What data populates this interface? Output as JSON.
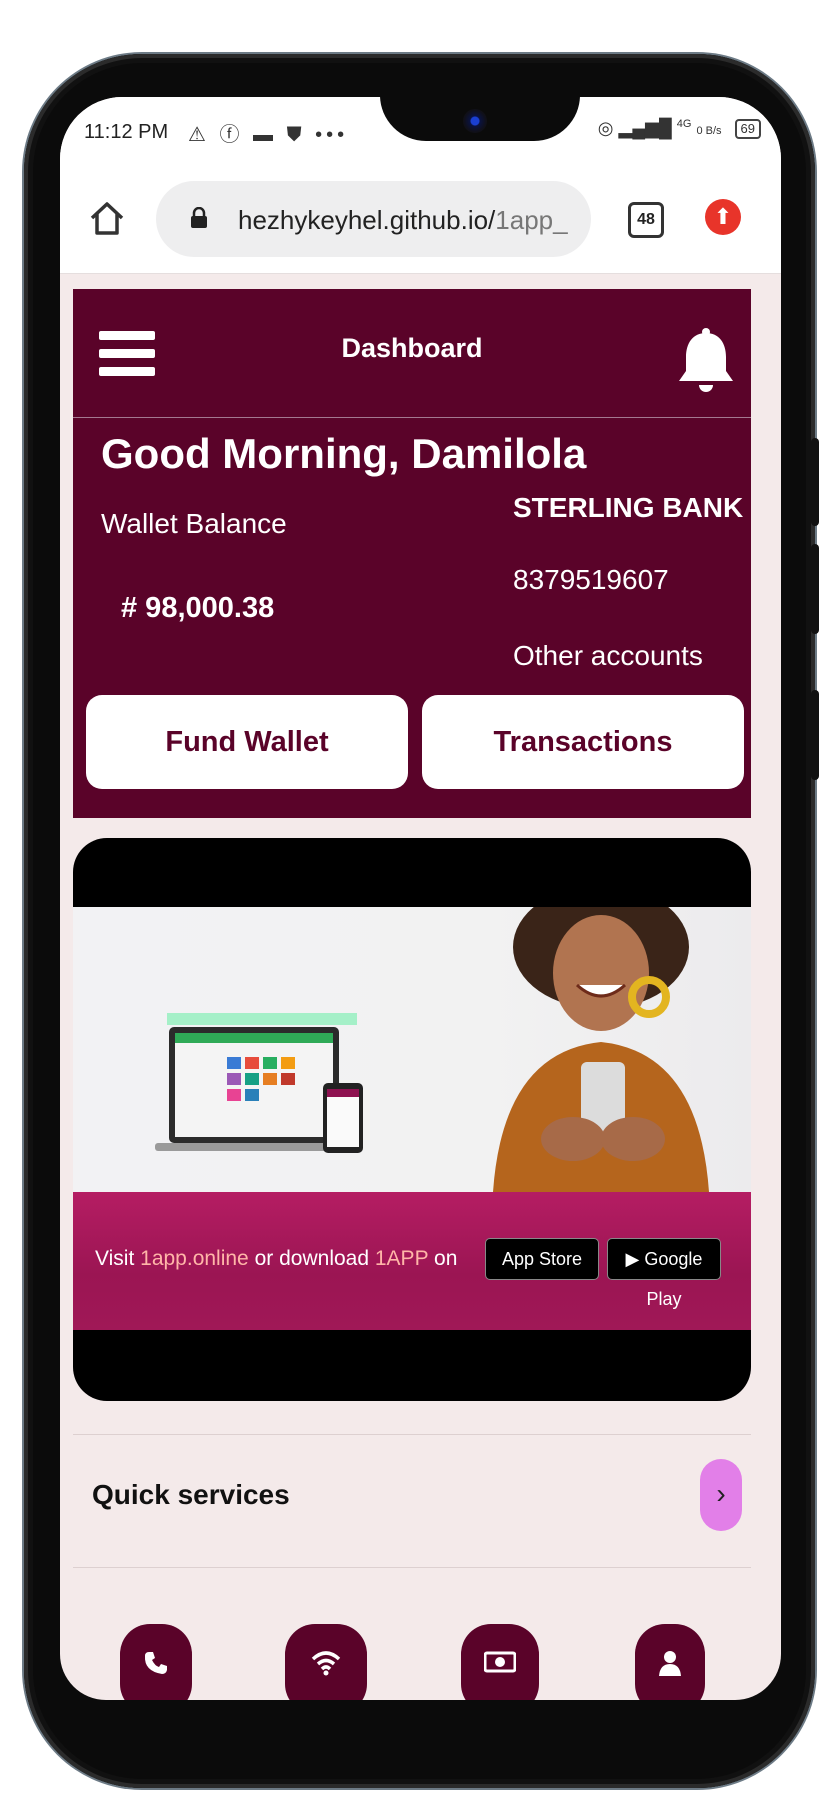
{
  "status_bar": {
    "time": "11:12 PM",
    "left_icons": "⚠ ⓕ ▬ ⛊ •••",
    "network": "4G",
    "speed": "0 B/s",
    "battery": "69"
  },
  "browser": {
    "url_host": "hezhykeyhel.github.io/",
    "url_path": "1app_",
    "tab_count": "48"
  },
  "header": {
    "title": "Dashboard"
  },
  "account": {
    "greeting": "Good Morning, Damilola",
    "wallet_label": "Wallet Balance",
    "balance": "# 98,000.38",
    "bank_name": "STERLING BANK",
    "account_number": "8379519607",
    "other_accounts": "Other accounts",
    "fund_wallet": "Fund Wallet",
    "transactions": "Transactions"
  },
  "banner": {
    "visit": "Visit",
    "site": "1app.online",
    "or": "or",
    "download": "download",
    "app_name": "1APP",
    "on": "on",
    "app_store": "App Store",
    "google_play": "Google Play"
  },
  "quick_services": {
    "label": "Quick services",
    "arrow": "›",
    "services": [
      "phone-icon",
      "wifi-icon",
      "cash-icon",
      "user-icon"
    ]
  },
  "colors": {
    "brand": "#5a0329",
    "background": "#f4eaea",
    "accent_arrow": "#e27fe8"
  }
}
